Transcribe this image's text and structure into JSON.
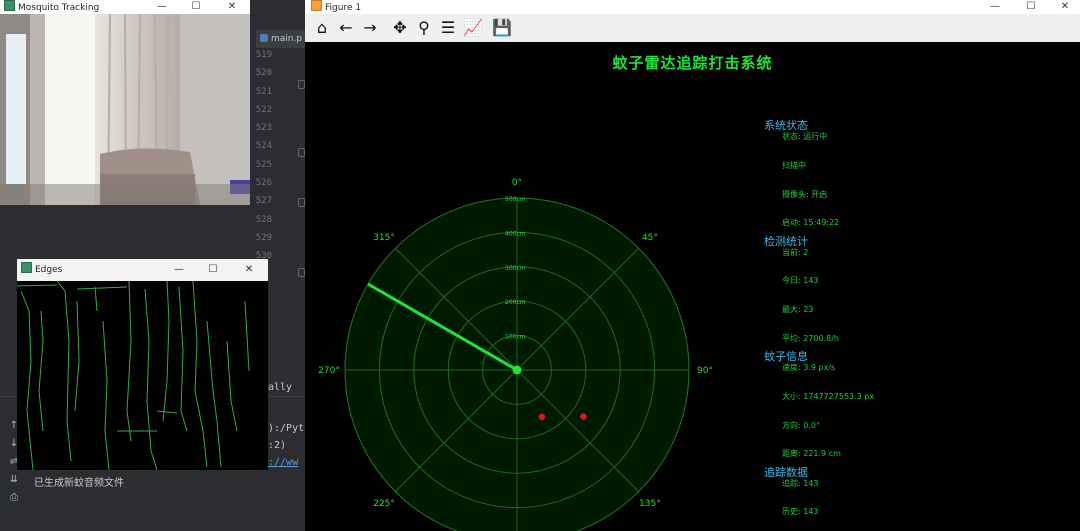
{
  "ide": {
    "tab_label": "main.p",
    "line_numbers": [
      "519",
      "520",
      "521",
      "522",
      "523",
      "524",
      "525",
      "526",
      "527",
      "528",
      "529",
      "530"
    ],
    "console": {
      "partial_word": "ally",
      "line1": "):/Pyt",
      "line2": ":2)",
      "line3_link": "://ww",
      "message": "已生成新蚊音频文件"
    },
    "side_tools": [
      "↑",
      "↓",
      "⇌",
      "⇊",
      "⎙"
    ]
  },
  "camera_window": {
    "title": "Mosquito Tracking",
    "controls": [
      "—",
      "☐",
      "✕"
    ]
  },
  "edges_window": {
    "title": "Edges",
    "controls": [
      "—",
      "☐",
      "✕"
    ]
  },
  "figure_window": {
    "title": "Figure 1",
    "controls": [
      "—",
      "☐",
      "✕"
    ],
    "toolbar": [
      {
        "name": "home-icon",
        "glyph": "⌂"
      },
      {
        "name": "back-arrow-icon",
        "glyph": "←"
      },
      {
        "name": "forward-arrow-icon",
        "glyph": "→"
      },
      {
        "name": "pan-icon",
        "glyph": "✥"
      },
      {
        "name": "zoom-icon",
        "glyph": "⚲"
      },
      {
        "name": "configure-subplots-icon",
        "glyph": "☰"
      },
      {
        "name": "edit-axes-icon",
        "glyph": "📈"
      },
      {
        "name": "save-icon",
        "glyph": "💾"
      }
    ],
    "heading": "蚊子雷达追踪打击系统"
  },
  "radar": {
    "angle_labels": [
      {
        "text": "0°",
        "angle": 0
      },
      {
        "text": "45°",
        "angle": 45
      },
      {
        "text": "90°",
        "angle": 90
      },
      {
        "text": "135°",
        "angle": 135
      },
      {
        "text": "225°",
        "angle": 225
      },
      {
        "text": "270°",
        "angle": 270
      },
      {
        "text": "315°",
        "angle": 315
      }
    ],
    "range_labels": [
      "100cm",
      "200cm",
      "300cm",
      "400cm",
      "500cm"
    ],
    "range_values": [
      100,
      200,
      300,
      400,
      500
    ],
    "max_range": 500,
    "sweep_angle_deg": 300,
    "targets": [
      {
        "angle_deg": 152,
        "distance_cm": 154
      },
      {
        "angle_deg": 125,
        "distance_cm": 236
      }
    ],
    "colors": {
      "grid": "#1f6b1f",
      "sweep": "#1ee43a",
      "target": "#e01515",
      "fill": "#001a00",
      "label": "#1ee43a"
    }
  },
  "info_panel": {
    "sections": [
      {
        "title": "系统状态",
        "lines": [
          "状态: 运行中",
          "扫描中",
          "摄像头: 开启",
          "启动: 15:49:22"
        ]
      },
      {
        "title": "检测统计",
        "lines": [
          "当前: 2",
          "今日: 143",
          "最大: 23",
          "平均: 2700.8/h"
        ]
      },
      {
        "title": "蚊子信息",
        "lines": [
          "速度: 3.9 px/s",
          "大小: 1747727553.3 px",
          "方向: 0.0°",
          "距离: 221.9 cm"
        ]
      },
      {
        "title": "追踪数据",
        "lines": [
          "追踪: 143",
          "历史: 143"
        ]
      }
    ]
  }
}
